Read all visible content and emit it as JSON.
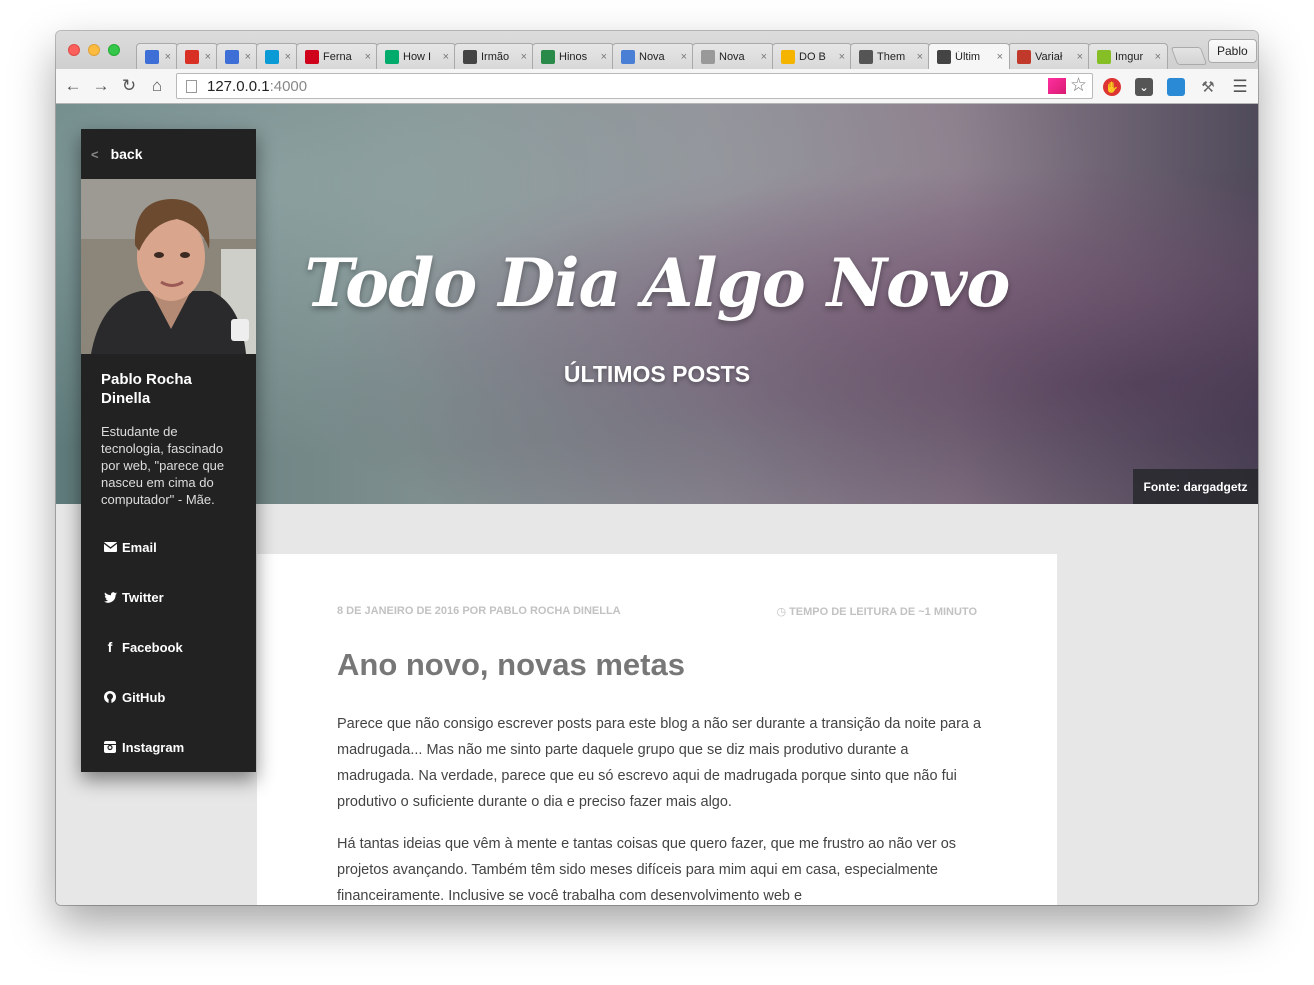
{
  "browser": {
    "tabs": [
      {
        "title": "",
        "icon": "inbox-icon",
        "color": "#3d6fd6"
      },
      {
        "title": "",
        "icon": "gmail-icon",
        "color": "#d93025"
      },
      {
        "title": "",
        "icon": "inbox-icon",
        "color": "#3d6fd6"
      },
      {
        "title": "",
        "icon": "trello-icon",
        "color": "#0a9bd6"
      },
      {
        "title": "Ferna",
        "icon": "shield-icon",
        "color": "#d0021b"
      },
      {
        "title": "How I",
        "icon": "medium-icon",
        "color": "#00ab6b"
      },
      {
        "title": "Irmão",
        "icon": "people-icon",
        "color": "#444444"
      },
      {
        "title": "Hinos",
        "icon": "globe-icon",
        "color": "#2a8a4a"
      },
      {
        "title": "Nova",
        "icon": "compass-icon",
        "color": "#4a7fd6"
      },
      {
        "title": "Nova",
        "icon": "page-icon",
        "color": "#999999"
      },
      {
        "title": "DO B",
        "icon": "drive-icon",
        "color": "#f4b400"
      },
      {
        "title": "Them",
        "icon": "square-icon",
        "color": "#555555"
      },
      {
        "title": "Últim",
        "icon": "square-icon",
        "color": "#444444"
      },
      {
        "title": "Variał",
        "icon": "info-icon",
        "color": "#c0392b"
      },
      {
        "title": "Imgur",
        "icon": "imgur-icon",
        "color": "#85bf25"
      }
    ],
    "profile_label": "Pablo",
    "address": {
      "host": "127.0.0.1",
      "port": ":4000"
    }
  },
  "hero": {
    "title": "Todo Dia Algo Novo",
    "subtitle": "ÚLTIMOS POSTS",
    "credit": "Fonte: dargadgetz"
  },
  "sidebar": {
    "back_label": "back",
    "name": "Pablo Rocha Dinella",
    "bio": "Estudante de tecnologia, fascinado por web, \"parece que nasceu em cima do computador\" - Mãe.",
    "links": [
      {
        "label": "Email",
        "icon": "envelope-icon"
      },
      {
        "label": "Twitter",
        "icon": "twitter-icon"
      },
      {
        "label": "Facebook",
        "icon": "facebook-icon"
      },
      {
        "label": "GitHub",
        "icon": "github-icon"
      },
      {
        "label": "Instagram",
        "icon": "instagram-icon"
      }
    ]
  },
  "post": {
    "meta_left": "8 de janeiro de 2016 por Pablo Rocha Dinella",
    "meta_right": "Tempo de leitura de ~1 minuto",
    "title": "Ano novo, novas metas",
    "paragraph1": "Parece que não consigo escrever posts para este blog a não ser durante a transição da noite para a madrugada... Mas não me sinto parte daquele grupo que se diz mais produtivo durante a madrugada. Na verdade, parece que eu só escrevo aqui de madrugada porque sinto que não fui produtivo o suficiente durante o dia e preciso fazer mais algo.",
    "paragraph2": "Há tantas ideias que vêm à mente e tantas coisas que quero fazer, que me frustro ao não ver os projetos avançando. Também têm sido meses difíceis para mim aqui em casa, especialmente financeiramente. Inclusive se você trabalha com desenvolvimento web e"
  }
}
